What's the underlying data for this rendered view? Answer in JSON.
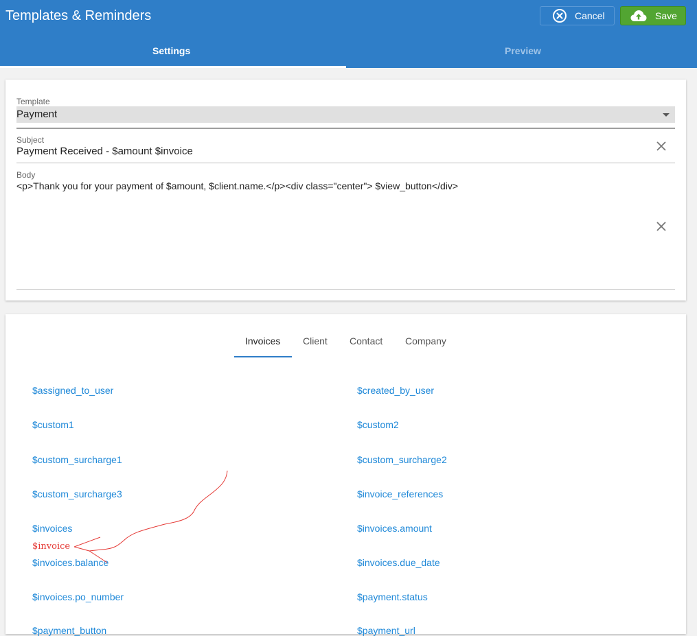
{
  "header": {
    "title": "Templates & Reminders",
    "cancel_label": "Cancel",
    "save_label": "Save"
  },
  "tabs": [
    "Settings",
    "Preview"
  ],
  "form": {
    "template_label": "Template",
    "template_value": "Payment",
    "subject_label": "Subject",
    "subject_value": "Payment Received - $amount $invoice",
    "body_label": "Body",
    "body_value": "<p>Thank you for your payment of $amount, $client.name.</p><div class=\"center\"> $view_button</div>"
  },
  "variable_tabs": [
    "Invoices",
    "Client",
    "Contact",
    "Company"
  ],
  "variables_left": [
    "$assigned_to_user",
    "$custom1",
    "$custom_surcharge1",
    "$custom_surcharge3",
    "$invoices",
    "$invoices.balance",
    "$invoices.po_number",
    "$payment_button"
  ],
  "variables_right": [
    "$created_by_user",
    "$custom2",
    "$custom_surcharge2",
    "$invoice_references",
    "$invoices.amount",
    "$invoices.due_date",
    "$payment.status",
    "$payment_url"
  ],
  "annotation": "$invoice",
  "colors": {
    "appbar": "#2f7ec8",
    "save": "#52a532",
    "link": "#1e88d8",
    "annotation": "#e53935"
  }
}
